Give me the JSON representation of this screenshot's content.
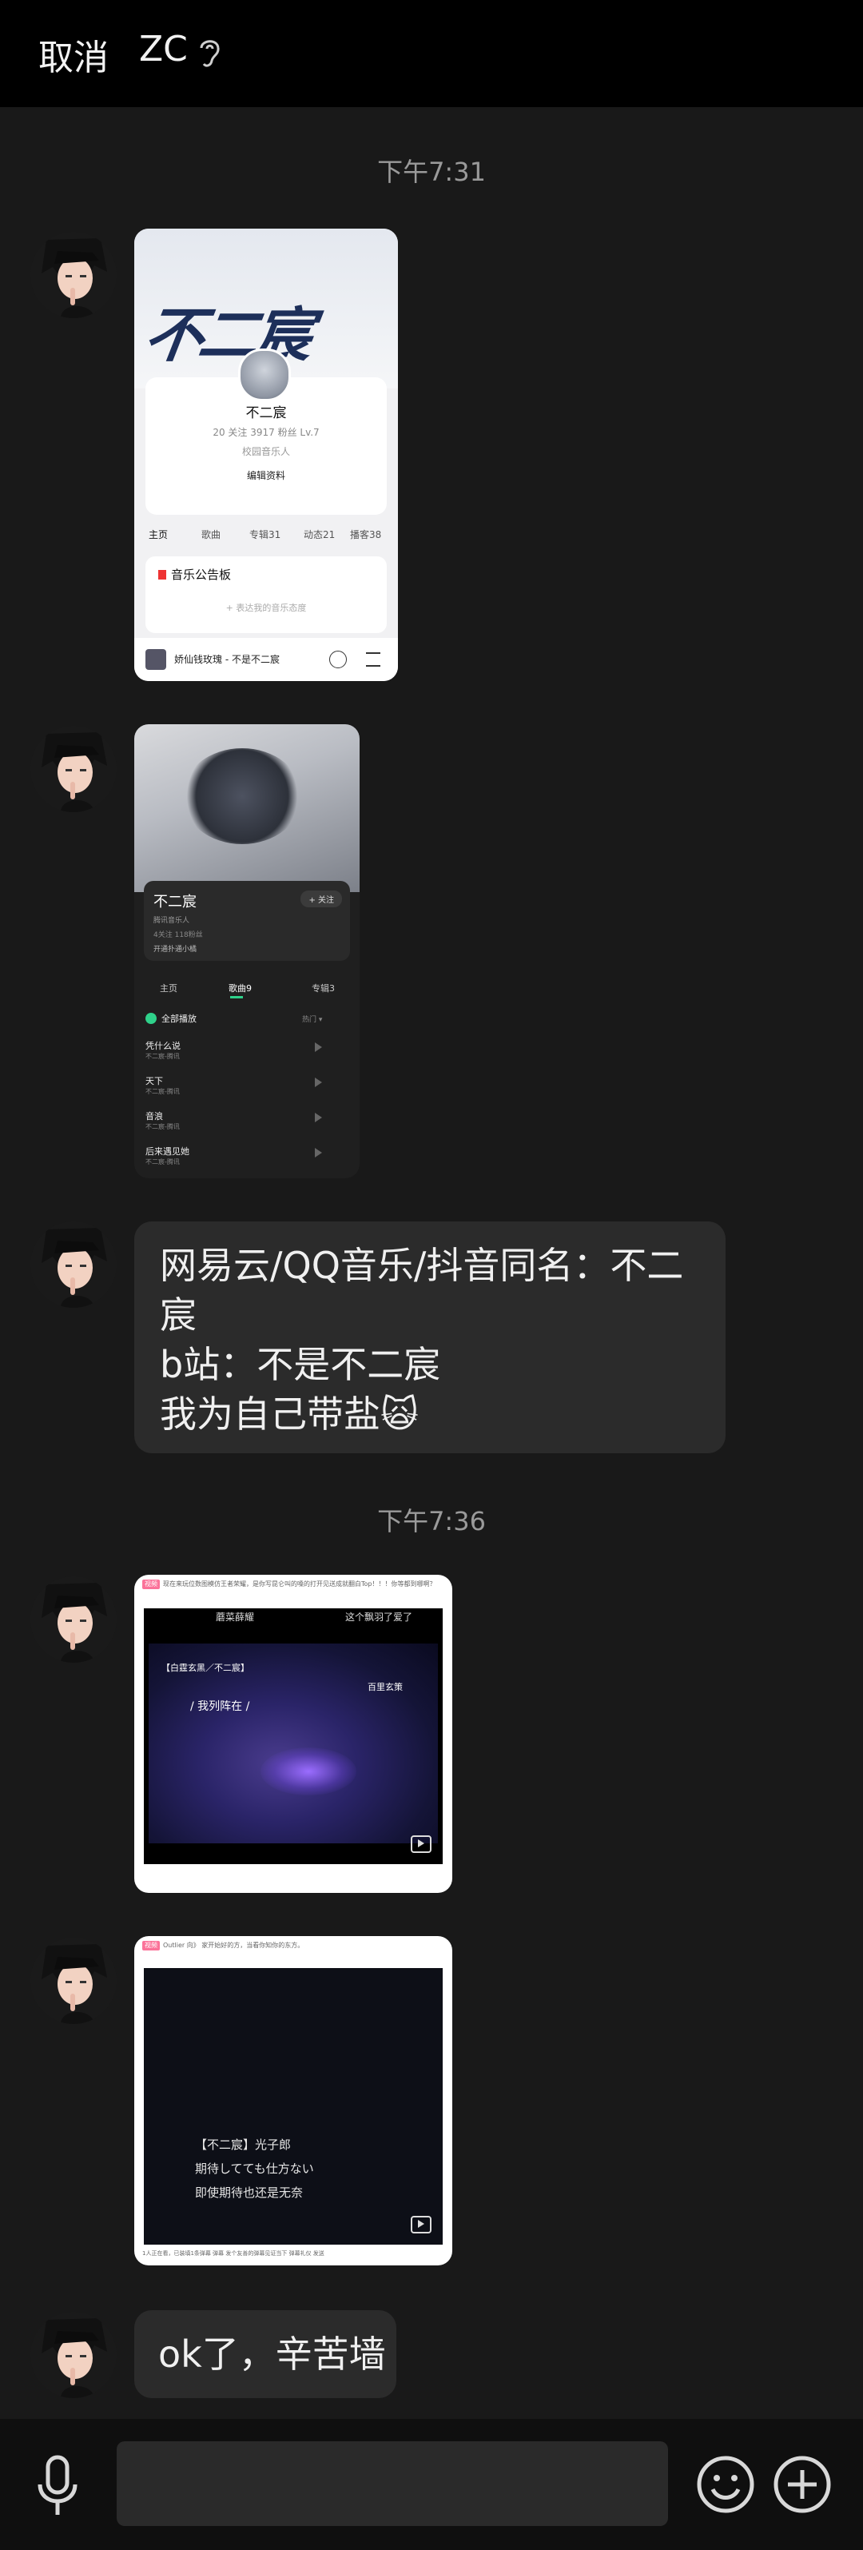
{
  "header": {
    "cancel_label": "取消",
    "chat_name": "ZC"
  },
  "timestamps": [
    "下午7:31",
    "下午7:36"
  ],
  "messages": {
    "text1_lines": [
      "网易云/QQ音乐/抖音同名：不二",
      "宸",
      "b站：不是不二宸",
      "我为自己带盐🙀"
    ],
    "text2": "ok了，辛苦墙"
  },
  "shot1": {
    "calligraphy": "不二宸",
    "name": "不二宸",
    "stats": "20 关注    3917 粉丝    Lv.7",
    "role": "校园音乐人",
    "edit": "编辑资料",
    "tabs": [
      "主页",
      "歌曲",
      "专辑31",
      "动态21",
      "播客38"
    ],
    "board_title": "音乐公告板",
    "board_placeholder": "+ 表达我的音乐态度",
    "now_playing": "娇仙钱玫瑰 - 不是不二宸"
  },
  "shot2": {
    "name": "不二宸",
    "follow": "+ 关注",
    "sub1": "腾讯音乐人",
    "sub2": "4关注  118粉丝",
    "sub3": "开通扑通小橘",
    "tabs": [
      "主页",
      "歌曲9",
      "专辑3"
    ],
    "play_all": "全部播放",
    "hot": "热门 ▾",
    "songs": [
      {
        "title": "凭什么说",
        "artist": "不二宸-腾讯"
      },
      {
        "title": "天下",
        "artist": "不二宸-腾讯"
      },
      {
        "title": "音浪",
        "artist": "不二宸-腾讯"
      },
      {
        "title": "后来遇见她",
        "artist": "不二宸-腾讯"
      }
    ]
  },
  "video1": {
    "tag": "视频",
    "headline": "现在来玩位数图模仿王者荣耀，是你写昆仑叫的嗓的打开见送成就翻白Top！！！你等都到哪啊？",
    "top_left": "蘑菜薛耀",
    "top_right": "这个飘羽了爱了",
    "subtitle1": "【白霆玄黑／不二宸】",
    "subtitle2": "/ 我列阵在 /",
    "zone": "百里玄策"
  },
  "video2": {
    "tag": "视频",
    "headline": "Outlier 向》 家开始好的方，当看你知你的东方。",
    "lyrics": [
      "【不二宸】光子郎",
      "期待してても仕方ない",
      "即使期待也还是无奈"
    ],
    "footer": "1人正在看，已装填1条弹幕      弹幕         发个友善的弹幕见证当下        弹幕礼仪   发送"
  }
}
